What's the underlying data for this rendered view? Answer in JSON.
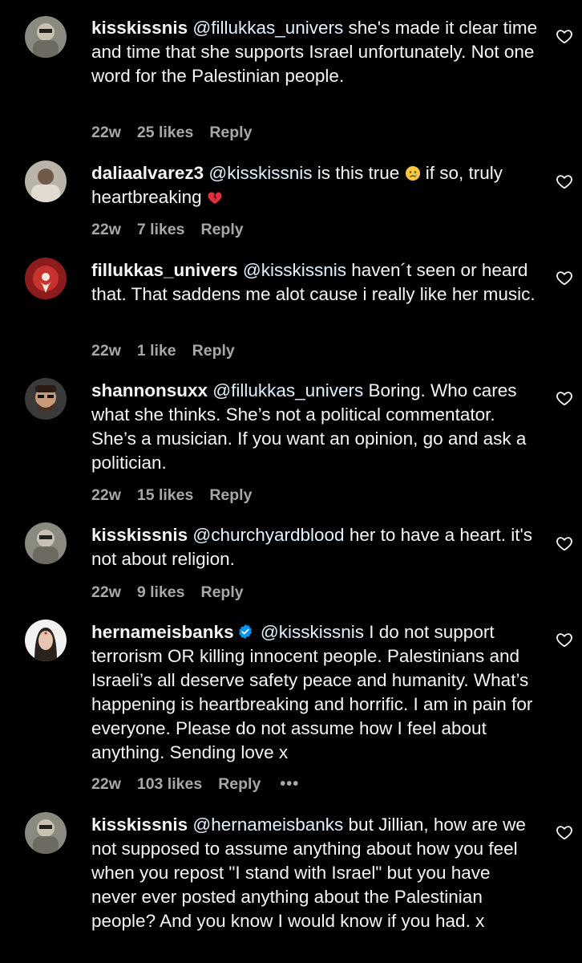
{
  "comments": [
    {
      "username": "kisskissnis",
      "mention": "@fillukkas_univers",
      "text": " she's made it clear time and time that she supports Israel unfortunately. Not one word for the Palestinian people.",
      "age": "22w",
      "likes": "25 likes",
      "reply": "Reply",
      "avatar_icon": "avatar-photo"
    },
    {
      "username": "daliaalvarez3",
      "mention": "@kisskissnis",
      "text_before_emoji": " is this true ",
      "emoji1": "crying-face-emoji",
      "text_after_emoji": " if so, truly heartbreaking ",
      "emoji2": "broken-heart-emoji",
      "age": "22w",
      "likes": "7 likes",
      "reply": "Reply",
      "avatar_icon": "avatar-photo"
    },
    {
      "username": "fillukkas_univers",
      "mention": "@kisskissnis",
      "text": " haven´t seen or heard that. That saddens me alot cause i really like her music.",
      "age": "22w",
      "likes": "1 like",
      "reply": "Reply",
      "avatar_icon": "avatar-photo"
    },
    {
      "username": "shannonsuxx",
      "mention": "@fillukkas_univers",
      "text": " Boring. Who cares what she thinks. She’s not a political commentator. She’s a musician. If you want an opinion, go and ask a politician.",
      "age": "22w",
      "likes": "15 likes",
      "reply": "Reply",
      "avatar_icon": "avatar-photo"
    },
    {
      "username": "kisskissnis",
      "mention": "@churchyardblood",
      "text": " her to have a heart. it's not about religion.",
      "age": "22w",
      "likes": "9 likes",
      "reply": "Reply",
      "avatar_icon": "avatar-photo"
    },
    {
      "username": "hernameisbanks",
      "verified": true,
      "mention": "@kisskissnis",
      "text": " I do not support terrorism OR killing innocent people. Palestinians and Israeli’s all deserve safety peace and humanity. What’s happening is heartbreaking and horrific. I am in pain for everyone. Please do not assume how I feel about anything. Sending love x",
      "age": "22w",
      "likes": "103 likes",
      "reply": "Reply",
      "more": "•••",
      "avatar_icon": "avatar-photo"
    },
    {
      "username": "kisskissnis",
      "mention": "@hernameisbanks",
      "text": " but Jillian, how are we not supposed to assume anything about how you feel when you repost \"I stand with Israel\" but you have never ever posted anything about the Palestinian people? And you know I would know if you had. x",
      "avatar_icon": "avatar-photo"
    }
  ],
  "colors": {
    "background": "#000000",
    "text": "#f5f5f5",
    "mention": "#e0f1ff",
    "meta": "#a8a8a8",
    "verified": "#0095f6"
  },
  "icons": {
    "like": "heart-outline-icon",
    "verified": "verified-badge-icon"
  }
}
